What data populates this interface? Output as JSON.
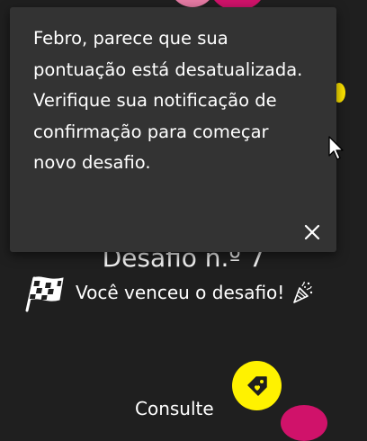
{
  "toast": {
    "message": "Febro, parece que sua pontuação está desatualizada. Verifique sua notificação de confirmação para começar novo desafio.",
    "close_icon": "close-icon"
  },
  "challenge": {
    "title": "Desafio n.º 7",
    "result_text": "Você venceu o desafio!",
    "flag_icon": "checkered-flag-icon",
    "celebration_icon": "party-popper-icon"
  },
  "actions": {
    "tag_icon": "tag-icon",
    "consult_label": "Consulte"
  },
  "colors": {
    "background": "#1f1f1f",
    "toast_background": "#333333",
    "accent_yellow": "#fff200",
    "accent_magenta": "#d0126a"
  }
}
